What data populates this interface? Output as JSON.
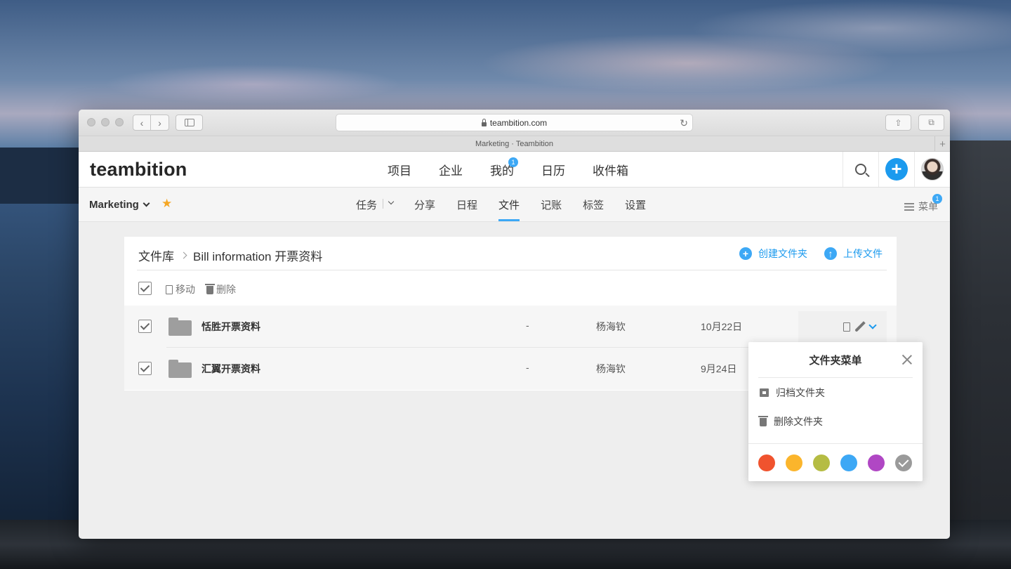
{
  "browser": {
    "url": "teambition.com",
    "tab_title": "Marketing · Teambition"
  },
  "app": {
    "logo": "teambition",
    "nav": [
      {
        "label": "项目"
      },
      {
        "label": "企业"
      },
      {
        "label": "我的",
        "badge": "1"
      },
      {
        "label": "日历"
      },
      {
        "label": "收件箱"
      }
    ]
  },
  "project": {
    "name": "Marketing",
    "tabs": [
      "任务",
      "分享",
      "日程",
      "文件",
      "记账",
      "标签",
      "设置"
    ],
    "active_tab": "文件",
    "menu_label": "菜单",
    "menu_badge": "1"
  },
  "library": {
    "root": "文件库",
    "current_folder": "Bill information 开票资料",
    "create_folder": "创建文件夹",
    "upload_file": "上传文件",
    "move_label": "移动",
    "delete_label": "删除"
  },
  "folders": [
    {
      "name": "恬胜开票资料",
      "size": "-",
      "owner": "杨海钦",
      "date": "10月22日"
    },
    {
      "name": "汇翼开票资料",
      "size": "-",
      "owner": "杨海钦",
      "date": "9月24日"
    }
  ],
  "folder_menu": {
    "title": "文件夹菜单",
    "archive": "归档文件夹",
    "delete": "删除文件夹",
    "colors": [
      "#f0532e",
      "#fbb52c",
      "#b5bc43",
      "#3da8f5",
      "#b047c4",
      "#9a9a9a"
    ],
    "selected_color": "#9a9a9a"
  }
}
